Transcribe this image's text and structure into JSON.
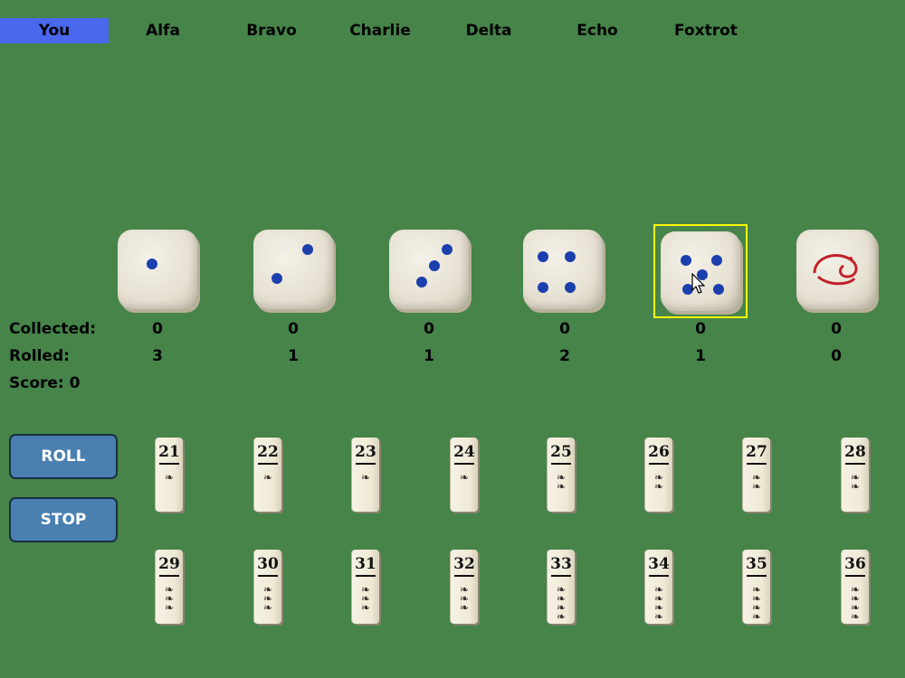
{
  "players": [
    "You",
    "Alfa",
    "Bravo",
    "Charlie",
    "Delta",
    "Echo",
    "Foxtrot"
  ],
  "active_player": "You",
  "dice": [
    {
      "face": "1"
    },
    {
      "face": "2"
    },
    {
      "face": "3"
    },
    {
      "face": "4"
    },
    {
      "face": "5",
      "selected": true
    },
    {
      "face": "worm"
    }
  ],
  "stats": {
    "collected_label": "Collected:",
    "rolled_label": "Rolled:",
    "score_label": "Score: 0",
    "collected": [
      "0",
      "0",
      "0",
      "0",
      "0",
      "0"
    ],
    "rolled": [
      "3",
      "1",
      "1",
      "2",
      "1",
      "0"
    ]
  },
  "buttons": {
    "roll": "ROLL",
    "stop": "STOP"
  },
  "tiles": [
    {
      "number": "21",
      "worms": 1
    },
    {
      "number": "22",
      "worms": 1
    },
    {
      "number": "23",
      "worms": 1
    },
    {
      "number": "24",
      "worms": 1
    },
    {
      "number": "25",
      "worms": 2
    },
    {
      "number": "26",
      "worms": 2
    },
    {
      "number": "27",
      "worms": 2
    },
    {
      "number": "28",
      "worms": 2
    },
    {
      "number": "29",
      "worms": 3
    },
    {
      "number": "30",
      "worms": 3
    },
    {
      "number": "31",
      "worms": 3
    },
    {
      "number": "32",
      "worms": 3
    },
    {
      "number": "33",
      "worms": 4
    },
    {
      "number": "34",
      "worms": 4
    },
    {
      "number": "35",
      "worms": 4
    },
    {
      "number": "36",
      "worms": 4
    }
  ],
  "colors": {
    "table": "#46844a",
    "active_tab": "#4a68ee",
    "pip": "#1c3fae",
    "button": "#4a80b0",
    "selection": "#ffff00"
  }
}
